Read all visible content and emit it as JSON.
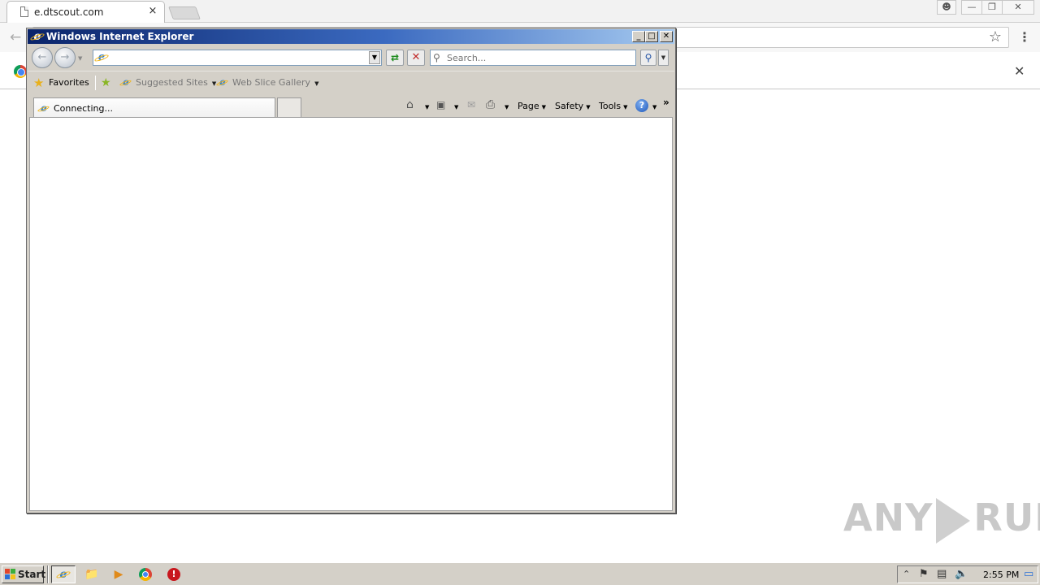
{
  "chrome": {
    "tab_title": "e.dtscout.com",
    "tab_close": "×",
    "infobar_close": "✕"
  },
  "ie": {
    "window_title": "Windows Internet Explorer",
    "address_value": "",
    "search_placeholder": "Search...",
    "favorites_label": "Favorites",
    "links": [
      {
        "label": "Suggested Sites"
      },
      {
        "label": "Web Slice Gallery"
      }
    ],
    "tab_title": "Connecting...",
    "commands": {
      "page": "Page",
      "safety": "Safety",
      "tools": "Tools"
    }
  },
  "watermark": {
    "left": "ANY",
    "right": "RUN"
  },
  "taskbar": {
    "start_label": "Start",
    "clock": "2:55 PM"
  },
  "colors": {
    "ie_title_start": "#0a246a",
    "ie_title_end": "#a6caf0",
    "taskbar": "#d4d0c8"
  }
}
